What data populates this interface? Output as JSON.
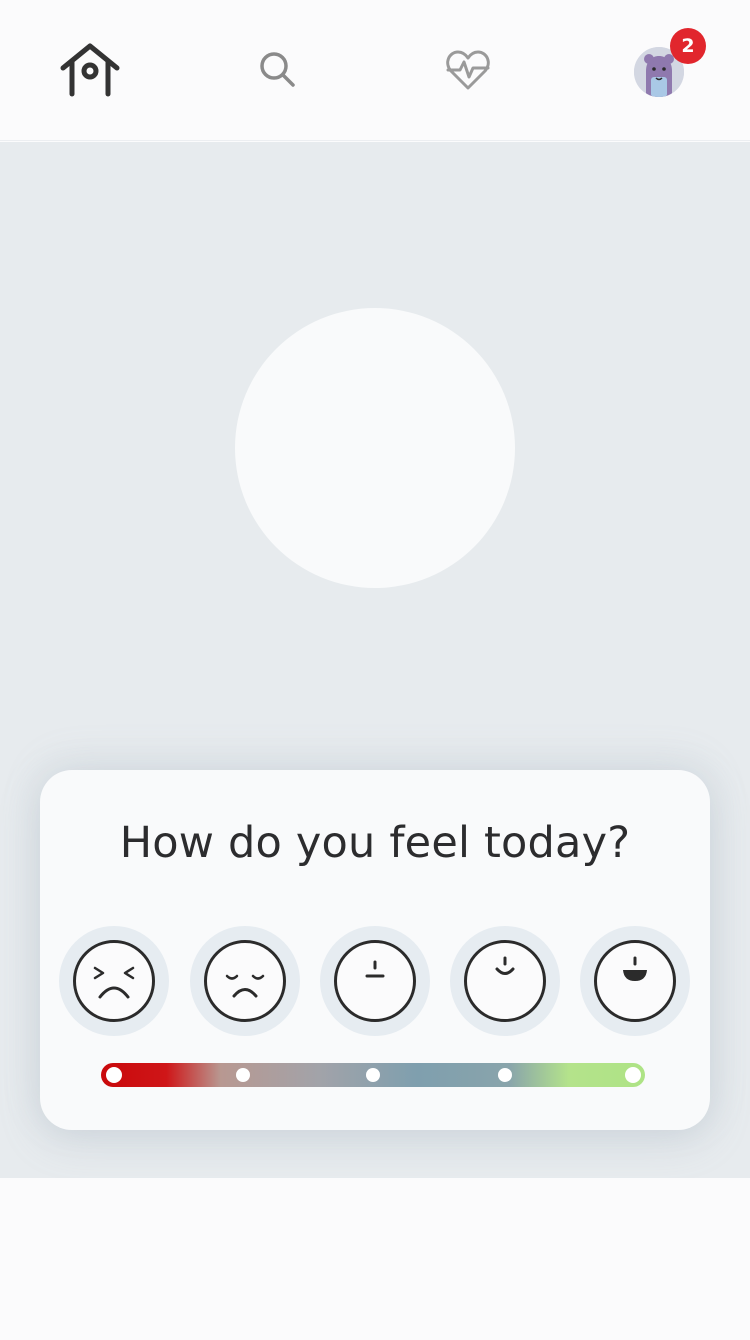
{
  "nav": {
    "items": [
      {
        "icon": "home-icon",
        "active": true
      },
      {
        "icon": "search-icon",
        "active": false
      },
      {
        "icon": "heartbeat-icon",
        "active": false
      },
      {
        "icon": "avatar",
        "active": false
      }
    ],
    "notification_count": "2"
  },
  "mood_card": {
    "title": "How do you feel today?",
    "options": [
      {
        "icon": "miserable-face-icon"
      },
      {
        "icon": "sad-face-icon"
      },
      {
        "icon": "neutral-face-icon"
      },
      {
        "icon": "happy-face-icon"
      },
      {
        "icon": "very-happy-face-icon"
      }
    ],
    "scale_colors": [
      "#c9080b",
      "#b89891",
      "#7f9fae",
      "#aee385"
    ]
  },
  "colors": {
    "accent_red": "#e1262d",
    "background": "#e7ebee",
    "text": "#2c2c2e"
  }
}
